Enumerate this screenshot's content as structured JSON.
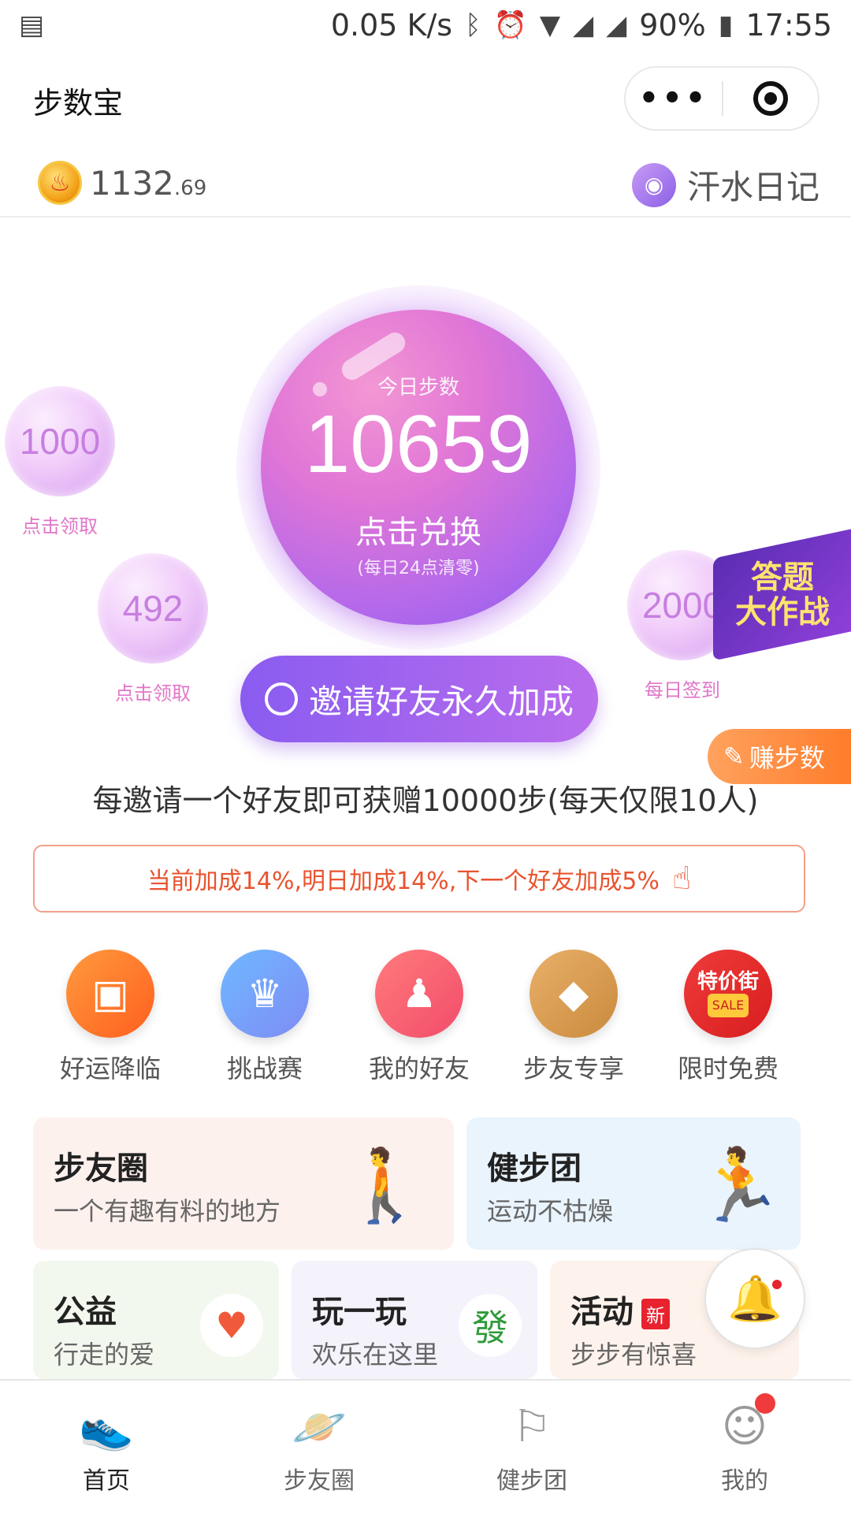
{
  "status_bar": {
    "speed": "0.05 K/s",
    "battery": "90%",
    "time": "17:55"
  },
  "title_bar": {
    "title": "步数宝"
  },
  "coins": {
    "integer": "1132",
    "decimal": ".69",
    "sweat_label": "汗水日记"
  },
  "main_bubble": {
    "title": "今日步数",
    "steps": "10659",
    "cta": "点击兑换",
    "note": "(每日24点清零)"
  },
  "bubbles": [
    {
      "value": "1000",
      "label": "点击领取"
    },
    {
      "value": "492",
      "label": "点击领取"
    },
    {
      "value": "2000",
      "label": "每日签到"
    }
  ],
  "quiz_badge": {
    "text": "答题\n大作战"
  },
  "earn_steps": {
    "label": "赚步数"
  },
  "invite": {
    "button_label": "邀请好友永久加成",
    "description": "每邀请一个好友即可获赠10000步(每天仅限10人)",
    "bonus": "当前加成14%,明日加成14%,下一个好友加成5%"
  },
  "grid": [
    {
      "label": "好运降临",
      "icon": "treasure-chest-icon",
      "color_from": "#ff9a3d",
      "color_to": "#ff5f1f"
    },
    {
      "label": "挑战赛",
      "icon": "trophy-icon",
      "color_from": "#6fb8ff",
      "color_to": "#7f8cf5"
    },
    {
      "label": "我的好友",
      "icon": "friends-icon",
      "color_from": "#ff7b7b",
      "color_to": "#f24c6b"
    },
    {
      "label": "步友专享",
      "icon": "diamond-icon",
      "color_from": "#e9b06a",
      "color_to": "#c98a3c"
    },
    {
      "label": "限时免费",
      "icon": "sale-bag-icon",
      "color_from": "#ef3b3b",
      "color_to": "#d81e1e",
      "badge_text": "特价街",
      "badge_sub": "SALE"
    }
  ],
  "cards": {
    "step_circle": {
      "title": "步友圈",
      "subtitle": "一个有趣有料的地方"
    },
    "walk_group": {
      "title": "健步团",
      "subtitle": "运动不枯燥"
    },
    "charity": {
      "title": "公益",
      "subtitle": "行走的爱"
    },
    "play": {
      "title": "玩一玩",
      "subtitle": "欢乐在这里",
      "emblem": "發"
    },
    "activity": {
      "title": "活动",
      "subtitle": "步步有惊喜",
      "badge": "新"
    }
  },
  "tabbar": [
    {
      "label": "首页",
      "icon": "sneaker-icon",
      "active": true
    },
    {
      "label": "步友圈",
      "icon": "planet-icon",
      "active": false
    },
    {
      "label": "健步团",
      "icon": "flag-icon",
      "active": false
    },
    {
      "label": "我的",
      "icon": "user-icon",
      "active": false
    }
  ],
  "colors": {
    "accent": "#8a5cf0",
    "pink": "#e176d6",
    "orange": "#ff7c2a",
    "red": "#e8222f"
  }
}
